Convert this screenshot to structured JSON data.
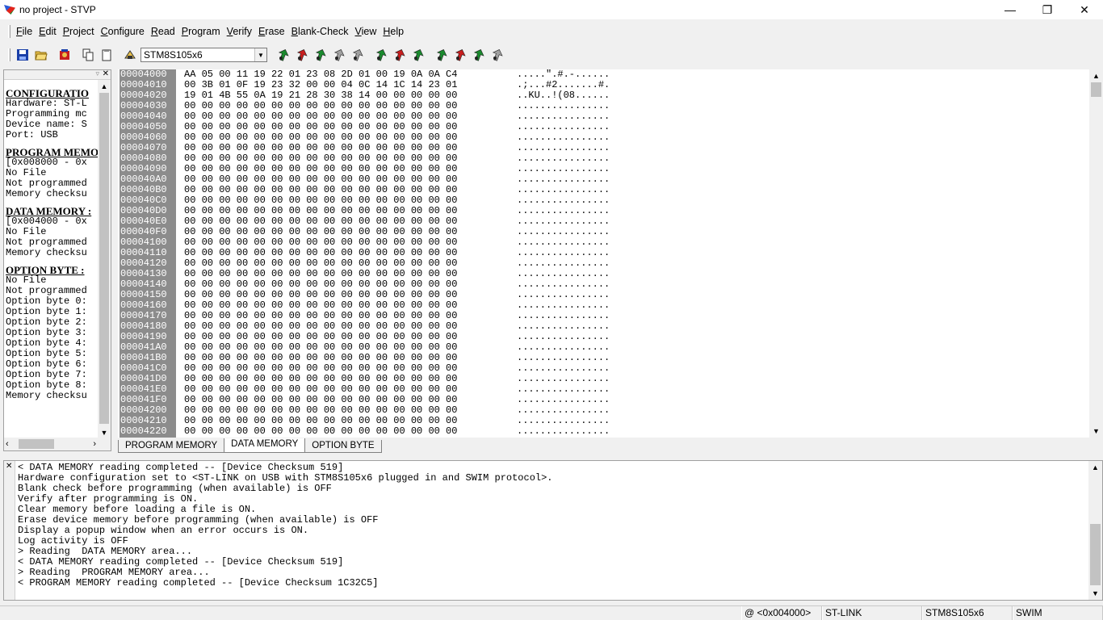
{
  "window": {
    "title": "no project - STVP",
    "minimize": "—",
    "maximize": "❐",
    "close": "✕"
  },
  "menu": {
    "items": [
      {
        "label": "File",
        "underline": "F",
        "rest": "ile"
      },
      {
        "label": "Edit",
        "underline": "E",
        "rest": "dit"
      },
      {
        "label": "Project",
        "underline": "P",
        "rest": "roject"
      },
      {
        "label": "Configure",
        "underline": "C",
        "rest": "onfigure"
      },
      {
        "label": "Read",
        "underline": "R",
        "rest": "ead"
      },
      {
        "label": "Program",
        "underline": "P",
        "rest": "rogram"
      },
      {
        "label": "Verify",
        "underline": "V",
        "rest": "erify"
      },
      {
        "label": "Erase",
        "underline": "E",
        "rest": "rase"
      },
      {
        "label": "Blank-Check",
        "underline": "B",
        "rest": "lank-Check"
      },
      {
        "label": "View",
        "underline": "V",
        "rest": "iew"
      },
      {
        "label": "Help",
        "underline": "H",
        "rest": "elp"
      }
    ]
  },
  "toolbar": {
    "device_select": "STM8S105x6",
    "colors": {
      "save": "#1a3fa8",
      "read": "#1a8a2e",
      "program": "#c81e1e",
      "disabled": "#a0a0a0"
    }
  },
  "info_panel": {
    "lines": [
      {
        "t": "CONFIGURATIO",
        "h": true
      },
      {
        "t": "Hardware: ST-L"
      },
      {
        "t": "Programming mc"
      },
      {
        "t": "Device name: S"
      },
      {
        "t": "Port: USB"
      },
      {
        "t": "PROGRAM MEMOI",
        "h": true
      },
      {
        "t": "[0x008000 - 0x"
      },
      {
        "t": "No File"
      },
      {
        "t": "Not programmed"
      },
      {
        "t": "Memory checksu"
      },
      {
        "t": "DATA MEMORY :",
        "h": true
      },
      {
        "t": "[0x004000 - 0x"
      },
      {
        "t": "No File"
      },
      {
        "t": "Not programmed"
      },
      {
        "t": "Memory checksu"
      },
      {
        "t": "OPTION BYTE :",
        "h": true
      },
      {
        "t": "No File"
      },
      {
        "t": "Not programmed"
      },
      {
        "t": "Option byte 0:"
      },
      {
        "t": "Option byte 1:"
      },
      {
        "t": "Option byte 2:"
      },
      {
        "t": "Option byte 3:"
      },
      {
        "t": "Option byte 4:"
      },
      {
        "t": "Option byte 5:"
      },
      {
        "t": "Option byte 6:"
      },
      {
        "t": "Option byte 7:"
      },
      {
        "t": "Option byte 8:"
      },
      {
        "t": "Memory checksu"
      }
    ]
  },
  "hex": {
    "rows": [
      {
        "addr": "00004000",
        "bytes": "AA 05 00 11 19 22 01 23 08 2D 01 00 19 0A 0A C4",
        "ascii": ".....\".#.-......"
      },
      {
        "addr": "00004010",
        "bytes": "00 3B 01 0F 19 23 32 00 00 04 0C 14 1C 14 23 01",
        "ascii": ".;...#2.......#."
      },
      {
        "addr": "00004020",
        "bytes": "19 01 4B 55 0A 19 21 28 30 38 14 00 00 00 00 00",
        "ascii": "..KU..!(08......"
      },
      {
        "addr": "00004030",
        "bytes": "00 00 00 00 00 00 00 00 00 00 00 00 00 00 00 00",
        "ascii": "................"
      },
      {
        "addr": "00004040",
        "bytes": "00 00 00 00 00 00 00 00 00 00 00 00 00 00 00 00",
        "ascii": "................"
      },
      {
        "addr": "00004050",
        "bytes": "00 00 00 00 00 00 00 00 00 00 00 00 00 00 00 00",
        "ascii": "................"
      },
      {
        "addr": "00004060",
        "bytes": "00 00 00 00 00 00 00 00 00 00 00 00 00 00 00 00",
        "ascii": "................"
      },
      {
        "addr": "00004070",
        "bytes": "00 00 00 00 00 00 00 00 00 00 00 00 00 00 00 00",
        "ascii": "................"
      },
      {
        "addr": "00004080",
        "bytes": "00 00 00 00 00 00 00 00 00 00 00 00 00 00 00 00",
        "ascii": "................"
      },
      {
        "addr": "00004090",
        "bytes": "00 00 00 00 00 00 00 00 00 00 00 00 00 00 00 00",
        "ascii": "................"
      },
      {
        "addr": "000040A0",
        "bytes": "00 00 00 00 00 00 00 00 00 00 00 00 00 00 00 00",
        "ascii": "................"
      },
      {
        "addr": "000040B0",
        "bytes": "00 00 00 00 00 00 00 00 00 00 00 00 00 00 00 00",
        "ascii": "................"
      },
      {
        "addr": "000040C0",
        "bytes": "00 00 00 00 00 00 00 00 00 00 00 00 00 00 00 00",
        "ascii": "................"
      },
      {
        "addr": "000040D0",
        "bytes": "00 00 00 00 00 00 00 00 00 00 00 00 00 00 00 00",
        "ascii": "................"
      },
      {
        "addr": "000040E0",
        "bytes": "00 00 00 00 00 00 00 00 00 00 00 00 00 00 00 00",
        "ascii": "................"
      },
      {
        "addr": "000040F0",
        "bytes": "00 00 00 00 00 00 00 00 00 00 00 00 00 00 00 00",
        "ascii": "................"
      },
      {
        "addr": "00004100",
        "bytes": "00 00 00 00 00 00 00 00 00 00 00 00 00 00 00 00",
        "ascii": "................"
      },
      {
        "addr": "00004110",
        "bytes": "00 00 00 00 00 00 00 00 00 00 00 00 00 00 00 00",
        "ascii": "................"
      },
      {
        "addr": "00004120",
        "bytes": "00 00 00 00 00 00 00 00 00 00 00 00 00 00 00 00",
        "ascii": "................"
      },
      {
        "addr": "00004130",
        "bytes": "00 00 00 00 00 00 00 00 00 00 00 00 00 00 00 00",
        "ascii": "................"
      },
      {
        "addr": "00004140",
        "bytes": "00 00 00 00 00 00 00 00 00 00 00 00 00 00 00 00",
        "ascii": "................"
      },
      {
        "addr": "00004150",
        "bytes": "00 00 00 00 00 00 00 00 00 00 00 00 00 00 00 00",
        "ascii": "................"
      },
      {
        "addr": "00004160",
        "bytes": "00 00 00 00 00 00 00 00 00 00 00 00 00 00 00 00",
        "ascii": "................"
      },
      {
        "addr": "00004170",
        "bytes": "00 00 00 00 00 00 00 00 00 00 00 00 00 00 00 00",
        "ascii": "................"
      },
      {
        "addr": "00004180",
        "bytes": "00 00 00 00 00 00 00 00 00 00 00 00 00 00 00 00",
        "ascii": "................"
      },
      {
        "addr": "00004190",
        "bytes": "00 00 00 00 00 00 00 00 00 00 00 00 00 00 00 00",
        "ascii": "................"
      },
      {
        "addr": "000041A0",
        "bytes": "00 00 00 00 00 00 00 00 00 00 00 00 00 00 00 00",
        "ascii": "................"
      },
      {
        "addr": "000041B0",
        "bytes": "00 00 00 00 00 00 00 00 00 00 00 00 00 00 00 00",
        "ascii": "................"
      },
      {
        "addr": "000041C0",
        "bytes": "00 00 00 00 00 00 00 00 00 00 00 00 00 00 00 00",
        "ascii": "................"
      },
      {
        "addr": "000041D0",
        "bytes": "00 00 00 00 00 00 00 00 00 00 00 00 00 00 00 00",
        "ascii": "................"
      },
      {
        "addr": "000041E0",
        "bytes": "00 00 00 00 00 00 00 00 00 00 00 00 00 00 00 00",
        "ascii": "................"
      },
      {
        "addr": "000041F0",
        "bytes": "00 00 00 00 00 00 00 00 00 00 00 00 00 00 00 00",
        "ascii": "................"
      },
      {
        "addr": "00004200",
        "bytes": "00 00 00 00 00 00 00 00 00 00 00 00 00 00 00 00",
        "ascii": "................"
      },
      {
        "addr": "00004210",
        "bytes": "00 00 00 00 00 00 00 00 00 00 00 00 00 00 00 00",
        "ascii": "................"
      },
      {
        "addr": "00004220",
        "bytes": "00 00 00 00 00 00 00 00 00 00 00 00 00 00 00 00",
        "ascii": "................"
      }
    ]
  },
  "tabs": [
    {
      "label": "PROGRAM MEMORY",
      "active": false
    },
    {
      "label": "DATA MEMORY",
      "active": true
    },
    {
      "label": "OPTION BYTE",
      "active": false
    }
  ],
  "log": {
    "lines": [
      "< DATA MEMORY reading completed -- [Device Checksum 519]",
      "Hardware configuration set to <ST-LINK on USB with STM8S105x6 plugged in and SWIM protocol>.",
      "Blank check before programming (when available) is OFF",
      "Verify after programming is ON.",
      "Clear memory before loading a file is ON.",
      "Erase device memory before programming (when available) is OFF",
      "Display a popup window when an error occurs is ON.",
      "Log activity is OFF",
      "> Reading  DATA MEMORY area...",
      "< DATA MEMORY reading completed -- [Device Checksum 519]",
      "> Reading  PROGRAM MEMORY area...",
      "< PROGRAM MEMORY reading completed -- [Device Checksum 1C32C5]"
    ]
  },
  "status": {
    "address": "@ <0x004000>",
    "hardware": "ST-LINK",
    "device": "STM8S105x6",
    "protocol": "SWIM"
  }
}
